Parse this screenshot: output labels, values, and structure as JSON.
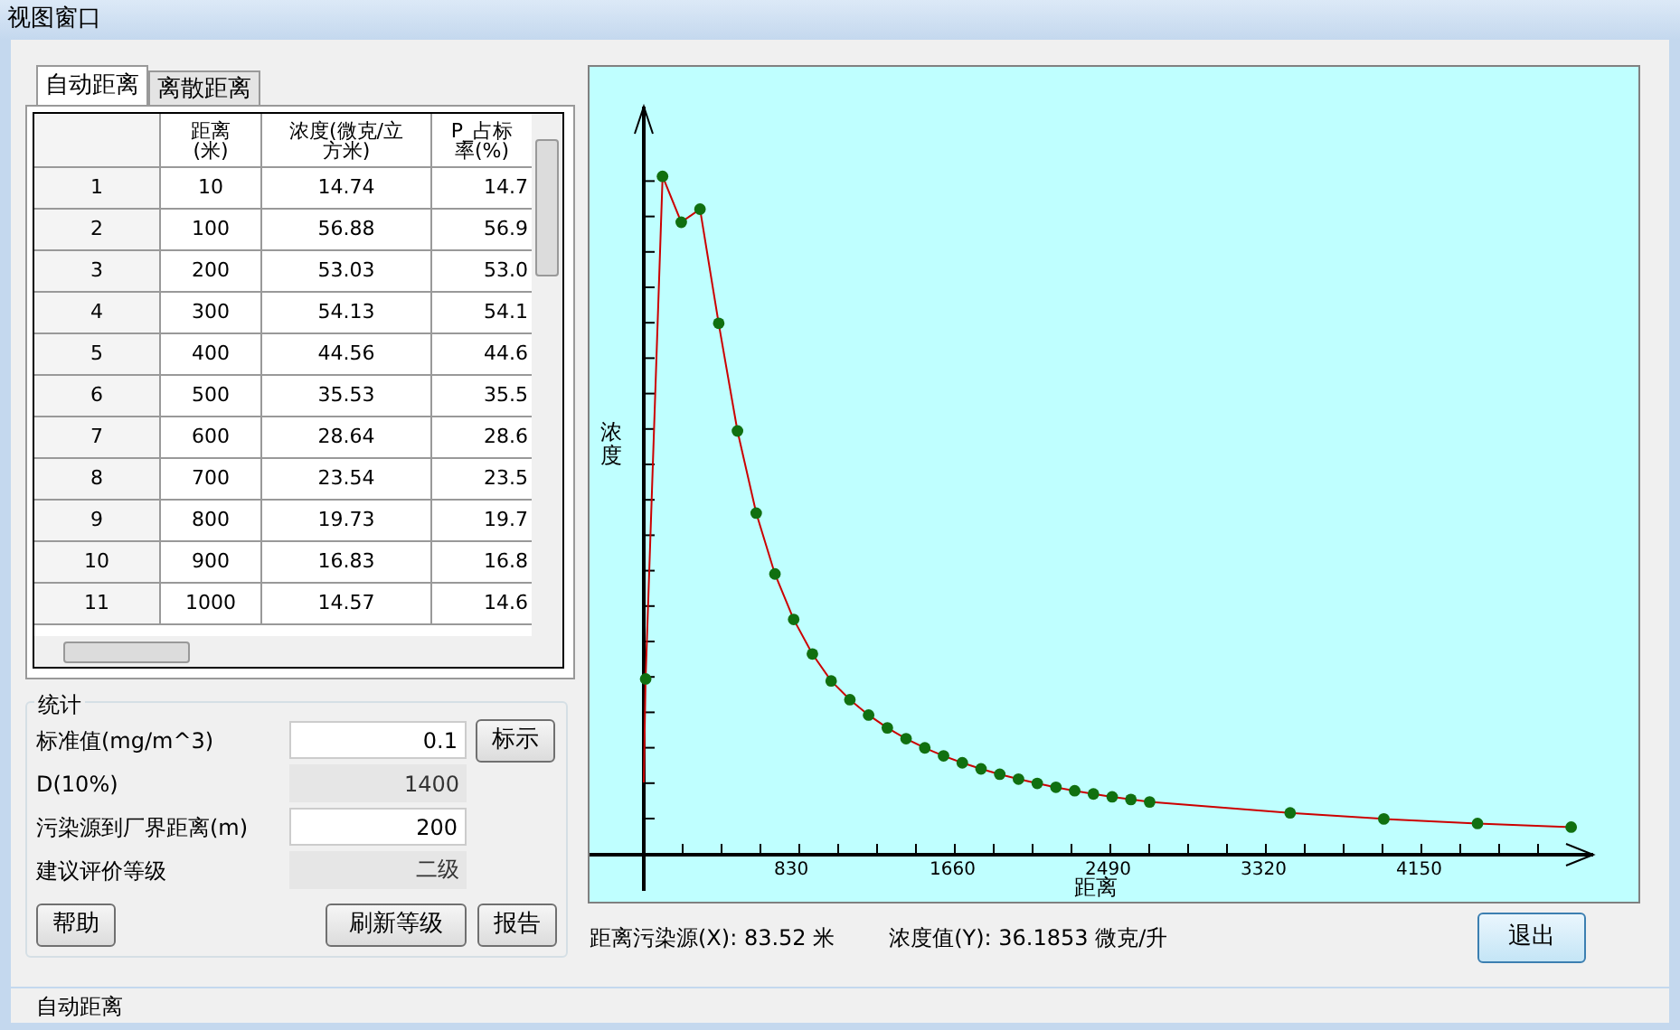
{
  "window": {
    "title": "视图窗口"
  },
  "tabs": [
    {
      "label": "自动距离",
      "selected": true
    },
    {
      "label": "离散距离",
      "selected": false
    }
  ],
  "table": {
    "columns": [
      "",
      "距离(米)",
      "浓度(微克/立方米)",
      "P_占标率(%)"
    ],
    "rows": [
      [
        "1",
        "10",
        "14.74",
        "14.7"
      ],
      [
        "2",
        "100",
        "56.88",
        "56.9"
      ],
      [
        "3",
        "200",
        "53.03",
        "53.0"
      ],
      [
        "4",
        "300",
        "54.13",
        "54.1"
      ],
      [
        "5",
        "400",
        "44.56",
        "44.6"
      ],
      [
        "6",
        "500",
        "35.53",
        "35.5"
      ],
      [
        "7",
        "600",
        "28.64",
        "28.6"
      ],
      [
        "8",
        "700",
        "23.54",
        "23.5"
      ],
      [
        "9",
        "800",
        "19.73",
        "19.7"
      ],
      [
        "10",
        "900",
        "16.83",
        "16.8"
      ],
      [
        "11",
        "1000",
        "14.57",
        "14.6"
      ]
    ]
  },
  "stats": {
    "title": "统计",
    "fields": [
      {
        "label": "标准值(mg/m^3)",
        "value": "0.1",
        "disabled": false,
        "button": "标示"
      },
      {
        "label": "D(10%)",
        "value": "1400",
        "disabled": true
      },
      {
        "label": "污染源到厂界距离(m)",
        "value": "200",
        "disabled": false
      },
      {
        "label": "建议评价等级",
        "value": "二级",
        "disabled": true
      }
    ],
    "buttons": [
      "帮助",
      "刷新等级",
      "报告"
    ]
  },
  "chart": {
    "ylabel": "浓度",
    "xlabel": "距离",
    "xticks": [
      "830",
      "1660",
      "2490",
      "3320",
      "4150"
    ]
  },
  "readout": [
    "距离污染源(X): 83.52 米",
    "浓度值(Y): 36.1853 微克/升"
  ],
  "exit_button": "退出",
  "status_bar": "自动距离"
}
